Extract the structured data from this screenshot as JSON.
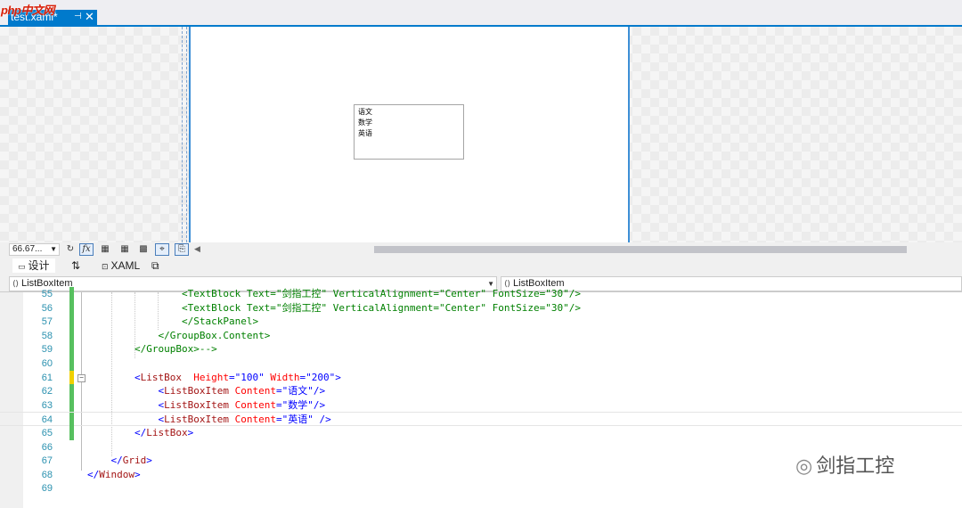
{
  "watermark": "php中文网",
  "document_tab": {
    "title": "test.xaml*",
    "pin_glyph": "⊣",
    "close_glyph": "✕"
  },
  "designer": {
    "listbox_items": [
      "语文",
      "数学",
      "英语"
    ]
  },
  "designer_toolbar": {
    "zoom": "66.67...",
    "refresh_glyph": "↻",
    "fx_label": "fx",
    "grid1_glyph": "▦",
    "grid2_glyph": "▦",
    "snap_glyph": "▩",
    "crosshair_glyph": "⌖",
    "device_glyph": "⎘",
    "scroll_left_glyph": "◀"
  },
  "split_tabs": {
    "design": "设计",
    "swap_glyph": "⇅",
    "xaml": "XAML",
    "popout_glyph": "⧉"
  },
  "navbar": {
    "left_combo": "ListBoxItem",
    "right_combo": "ListBoxItem"
  },
  "code_lines": [
    {
      "num": "55",
      "text": "<TextBlock Text=\"剑指工控\" VerticalAlignment=\"Center\" FontSize=\"30\"/>",
      "indent": "                ",
      "kind": "comment",
      "change": "green"
    },
    {
      "num": "56",
      "text": "<TextBlock Text=\"剑指工控\" VerticalAlignment=\"Center\" FontSize=\"30\"/>",
      "indent": "                ",
      "kind": "comment",
      "change": "green"
    },
    {
      "num": "57",
      "text": "</StackPanel>",
      "indent": "                ",
      "kind": "comment",
      "change": "green"
    },
    {
      "num": "58",
      "text": "</GroupBox.Content>",
      "indent": "            ",
      "kind": "comment",
      "change": "green"
    },
    {
      "num": "59",
      "text": "</GroupBox>-->",
      "indent": "        ",
      "kind": "comment",
      "change": "green"
    },
    {
      "num": "60",
      "text": "",
      "indent": "",
      "kind": "plain",
      "change": "green"
    },
    {
      "num": "61",
      "indent": "        ",
      "kind": "xml",
      "change": "yellow",
      "parts": [
        [
          "b",
          "<"
        ],
        [
          "t",
          "ListBox"
        ],
        [
          "a",
          "  Height"
        ],
        [
          "b",
          "=\""
        ],
        [
          "b",
          "100"
        ],
        [
          "b",
          "\""
        ],
        [
          "a",
          " Width"
        ],
        [
          "b",
          "=\""
        ],
        [
          "b",
          "200"
        ],
        [
          "b",
          "\">"
        ]
      ]
    },
    {
      "num": "62",
      "indent": "            ",
      "kind": "xml",
      "change": "green",
      "parts": [
        [
          "b",
          "<"
        ],
        [
          "t",
          "ListBoxItem"
        ],
        [
          "a",
          " Content"
        ],
        [
          "b",
          "=\""
        ],
        [
          "b",
          "语文"
        ],
        [
          "b",
          "\"/>"
        ]
      ]
    },
    {
      "num": "63",
      "indent": "            ",
      "kind": "xml",
      "change": "green",
      "parts": [
        [
          "b",
          "<"
        ],
        [
          "t",
          "ListBoxItem"
        ],
        [
          "a",
          " Content"
        ],
        [
          "b",
          "=\""
        ],
        [
          "b",
          "数学"
        ],
        [
          "b",
          "\"/>"
        ]
      ]
    },
    {
      "num": "64",
      "indent": "            ",
      "kind": "xml",
      "change": "green",
      "parts": [
        [
          "b",
          "<"
        ],
        [
          "t",
          "ListBoxItem"
        ],
        [
          "a",
          " Content"
        ],
        [
          "b",
          "=\""
        ],
        [
          "b",
          "英语"
        ],
        [
          "b",
          "\" />"
        ]
      ]
    },
    {
      "num": "65",
      "indent": "        ",
      "kind": "xml",
      "change": "green",
      "parts": [
        [
          "b",
          "</"
        ],
        [
          "t",
          "ListBox"
        ],
        [
          "b",
          ">"
        ]
      ]
    },
    {
      "num": "66",
      "text": "",
      "indent": "",
      "kind": "plain",
      "change": "none"
    },
    {
      "num": "67",
      "indent": "    ",
      "kind": "xml",
      "change": "none",
      "parts": [
        [
          "b",
          "</"
        ],
        [
          "t",
          "Grid"
        ],
        [
          "b",
          ">"
        ]
      ]
    },
    {
      "num": "68",
      "indent": "",
      "kind": "xml",
      "change": "none",
      "parts": [
        [
          "b",
          "</"
        ],
        [
          "t",
          "Window"
        ],
        [
          "b",
          ">"
        ]
      ]
    },
    {
      "num": "69",
      "text": "",
      "indent": "",
      "kind": "plain",
      "change": "none"
    }
  ],
  "brand": {
    "icon_glyph": "◎",
    "text": "剑指工控"
  }
}
